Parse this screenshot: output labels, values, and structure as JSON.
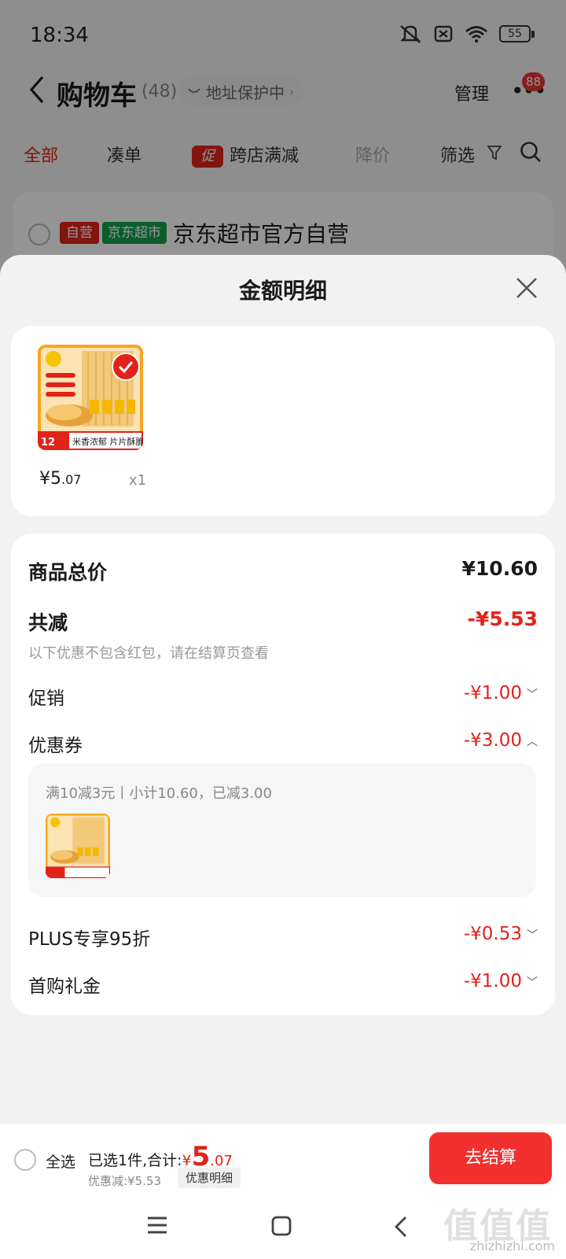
{
  "status_bar": {
    "time": "18:34",
    "battery": "55"
  },
  "header": {
    "title": "购物车",
    "count": "(48)",
    "address_label": "地址保护中",
    "manage_label": "管理",
    "message_badge": "88"
  },
  "filters": {
    "tabs": [
      "全部",
      "凑单",
      "跨店满减",
      "降价",
      "筛选"
    ],
    "promo_tag": "促"
  },
  "shop": {
    "tag_self": "自营",
    "tag_super": "京东超市",
    "name": "京东超市官方自营"
  },
  "sheet": {
    "title": "金额明细",
    "item": {
      "price_int": "¥5",
      "price_dec": ".07",
      "qty": "x1"
    },
    "rows": {
      "total_label": "商品总价",
      "total_value": "¥10.60",
      "reduce_label": "共减",
      "reduce_value": "-¥5.53",
      "reduce_note": "以下优惠不包含红包，请在结算页查看",
      "promo_label": "促销",
      "promo_value": "-¥1.00",
      "coupon_label": "优惠券",
      "coupon_value": "-¥3.00",
      "coupon_detail": "满10减3元丨小计10.60，已减3.00",
      "plus_label": "PLUS专享95折",
      "plus_value": "-¥0.53",
      "firstbuy_label": "首购礼金",
      "firstbuy_value": "-¥1.00"
    }
  },
  "action_bar": {
    "select_all": "全选",
    "summary_prefix": "已选1件,合计:",
    "total_yen": "¥",
    "total_int": "5",
    "total_dec": ".07",
    "discount": "优惠减:¥5.53",
    "detail_button": "优惠明细",
    "checkout": "去结算"
  },
  "watermark": {
    "mark": "值值值",
    "site": "zhizhizhi.com"
  },
  "colors": {
    "accent": "#e2231a",
    "checkout": "#f23030",
    "green_tag": "#13a34a"
  },
  "icons": [
    "back-icon",
    "chevron-down-icon",
    "funnel-icon",
    "search-icon",
    "close-icon",
    "check-icon",
    "menu-icon",
    "home-icon",
    "back-nav-icon"
  ]
}
